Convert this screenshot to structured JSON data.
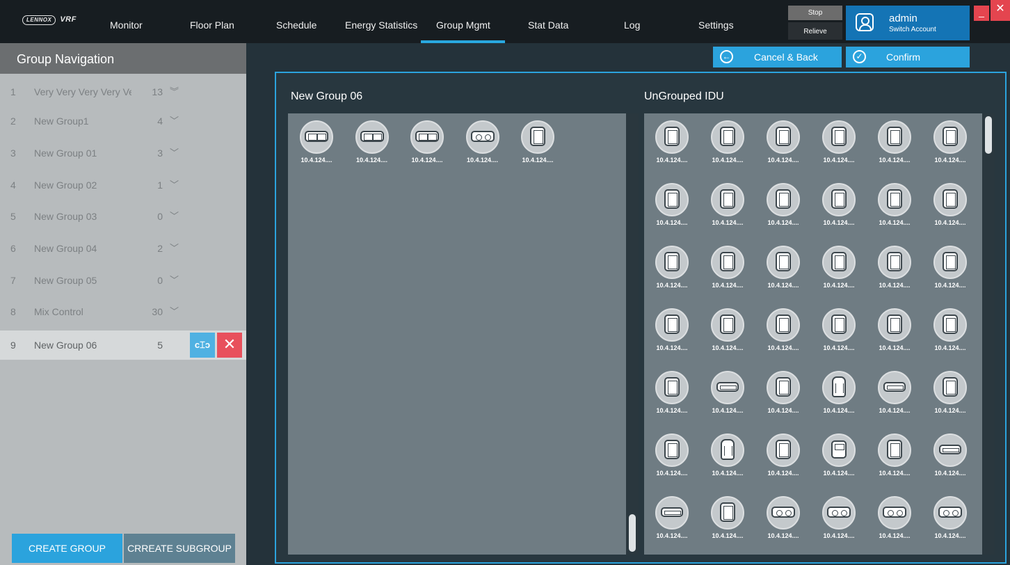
{
  "app": {
    "logo": "LENNOX",
    "logo_suffix": "VRF"
  },
  "nav": [
    {
      "label": "Monitor"
    },
    {
      "label": "Floor Plan"
    },
    {
      "label": "Schedule"
    },
    {
      "label": "Energy Statistics"
    },
    {
      "label": "Group Mgmt",
      "active": true
    },
    {
      "label": "Stat Data"
    },
    {
      "label": "Log"
    },
    {
      "label": "Settings"
    }
  ],
  "alarm": {
    "stop_label": "Stop",
    "relieve_label": "Relieve"
  },
  "user": {
    "name": "admin",
    "switch_label": "Switch Account",
    "icon": "user-circle-icon"
  },
  "window": {
    "minimize": "_",
    "close": "✕"
  },
  "sidebar": {
    "title": "Group Navigation",
    "groups": [
      {
        "num": "1",
        "name": "Very Very Very Very Ve",
        "count": "13",
        "chevron": "double-chevron-down-icon"
      },
      {
        "num": "2",
        "name": "New Group1",
        "count": "4",
        "chevron": "chevron-down-icon"
      },
      {
        "num": "3",
        "name": "New Group 01",
        "count": "3",
        "chevron": "chevron-down-icon"
      },
      {
        "num": "4",
        "name": "New Group 02",
        "count": "1",
        "chevron": "chevron-down-icon"
      },
      {
        "num": "5",
        "name": "New Group 03",
        "count": "0",
        "chevron": "chevron-down-icon"
      },
      {
        "num": "6",
        "name": "New Group 04",
        "count": "2",
        "chevron": "chevron-down-icon"
      },
      {
        "num": "7",
        "name": "New Group 05",
        "count": "0",
        "chevron": "chevron-down-icon"
      },
      {
        "num": "8",
        "name": "Mix Control",
        "count": "30",
        "chevron": "chevron-down-icon"
      },
      {
        "num": "9",
        "name": "New Group 06",
        "count": "5",
        "selected": true
      }
    ],
    "edit_icon": "rename-icon",
    "delete_icon": "close-icon",
    "create_group_label": "CREATE GROUP",
    "create_subgroup_label": "CRREATE SUBGROUP"
  },
  "toolbar": {
    "cancel_label": "Cancel & Back",
    "cancel_icon": "arrow-left-circle-icon",
    "confirm_label": "Confirm",
    "confirm_icon": "check-circle-icon"
  },
  "group_panel": {
    "title": "New Group 06",
    "devices": [
      {
        "ip": "10.4.124....",
        "icon": "dual-cassette-icon"
      },
      {
        "ip": "10.4.124....",
        "icon": "dual-cassette-icon"
      },
      {
        "ip": "10.4.124....",
        "icon": "dual-cassette-icon"
      },
      {
        "ip": "10.4.124....",
        "icon": "round-vent-cassette-icon"
      },
      {
        "ip": "10.4.124....",
        "icon": "cassette-icon"
      }
    ]
  },
  "ungrouped_panel": {
    "title": "UnGrouped IDU",
    "devices": [
      {
        "ip": "10.4.124....",
        "icon": "cassette-icon"
      },
      {
        "ip": "10.4.124....",
        "icon": "cassette-icon"
      },
      {
        "ip": "10.4.124....",
        "icon": "cassette-icon"
      },
      {
        "ip": "10.4.124....",
        "icon": "cassette-icon"
      },
      {
        "ip": "10.4.124....",
        "icon": "cassette-icon"
      },
      {
        "ip": "10.4.124....",
        "icon": "cassette-icon"
      },
      {
        "ip": "10.4.124....",
        "icon": "cassette-icon"
      },
      {
        "ip": "10.4.124....",
        "icon": "cassette-icon"
      },
      {
        "ip": "10.4.124....",
        "icon": "cassette-icon"
      },
      {
        "ip": "10.4.124....",
        "icon": "cassette-icon"
      },
      {
        "ip": "10.4.124....",
        "icon": "cassette-icon"
      },
      {
        "ip": "10.4.124....",
        "icon": "cassette-icon"
      },
      {
        "ip": "10.4.124....",
        "icon": "cassette-icon"
      },
      {
        "ip": "10.4.124....",
        "icon": "cassette-icon"
      },
      {
        "ip": "10.4.124....",
        "icon": "cassette-icon"
      },
      {
        "ip": "10.4.124....",
        "icon": "cassette-icon"
      },
      {
        "ip": "10.4.124....",
        "icon": "cassette-icon"
      },
      {
        "ip": "10.4.124....",
        "icon": "cassette-icon"
      },
      {
        "ip": "10.4.124....",
        "icon": "cassette-icon"
      },
      {
        "ip": "10.4.124....",
        "icon": "cassette-icon"
      },
      {
        "ip": "10.4.124....",
        "icon": "cassette-icon"
      },
      {
        "ip": "10.4.124....",
        "icon": "cassette-icon"
      },
      {
        "ip": "10.4.124....",
        "icon": "cassette-icon"
      },
      {
        "ip": "10.4.124....",
        "icon": "cassette-icon"
      },
      {
        "ip": "10.4.124....",
        "icon": "cassette-icon"
      },
      {
        "ip": "10.4.124....",
        "icon": "duct-icon"
      },
      {
        "ip": "10.4.124....",
        "icon": "cassette-icon"
      },
      {
        "ip": "10.4.124....",
        "icon": "floor-standing-icon"
      },
      {
        "ip": "10.4.124....",
        "icon": "duct-icon"
      },
      {
        "ip": "10.4.124....",
        "icon": "cassette-icon"
      },
      {
        "ip": "10.4.124....",
        "icon": "cassette-icon"
      },
      {
        "ip": "10.4.124....",
        "icon": "floor-standing-icon"
      },
      {
        "ip": "10.4.124....",
        "icon": "cassette-icon"
      },
      {
        "ip": "10.4.124....",
        "icon": "wall-mounted-icon"
      },
      {
        "ip": "10.4.124....",
        "icon": "cassette-icon"
      },
      {
        "ip": "10.4.124....",
        "icon": "duct-icon"
      },
      {
        "ip": "10.4.124....",
        "icon": "duct-icon"
      },
      {
        "ip": "10.4.124....",
        "icon": "cassette-icon"
      },
      {
        "ip": "10.4.124....",
        "icon": "round-vent-cassette-icon"
      },
      {
        "ip": "10.4.124....",
        "icon": "round-vent-cassette-icon"
      },
      {
        "ip": "10.4.124....",
        "icon": "round-vent-cassette-icon"
      },
      {
        "ip": "10.4.124....",
        "icon": "round-vent-cassette-icon"
      }
    ]
  },
  "colors": {
    "accent": "#2ba3dd",
    "delete": "#e8505c",
    "topbar": "#171d21",
    "user_box": "#1474b5"
  }
}
